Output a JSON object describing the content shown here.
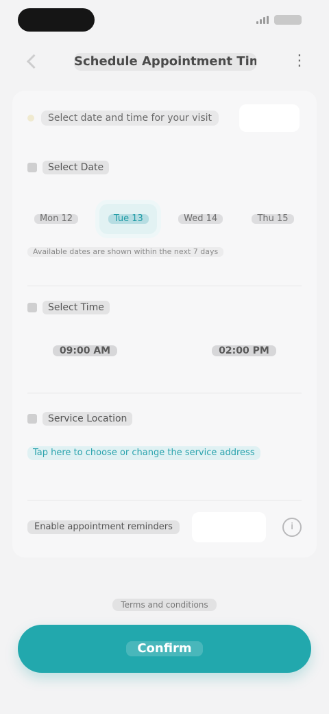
{
  "header": {
    "title": "Schedule Appointment Time",
    "more_icon": "more-icon"
  },
  "hint": {
    "text": "Select date and time for your visit"
  },
  "sections": {
    "date": {
      "label": "Select Date",
      "options": [
        {
          "label": "Mon 12",
          "selected": false
        },
        {
          "label": "Tue 13",
          "selected": true
        },
        {
          "label": "Wed 14",
          "selected": false
        },
        {
          "label": "Thu 15",
          "selected": false
        }
      ],
      "note": "Available dates are shown within the next 7 days"
    },
    "time": {
      "label": "Select Time",
      "options": [
        "09:00 AM",
        "02:00 PM"
      ]
    },
    "location": {
      "label": "Service Location",
      "link_text": "Tap here to choose or change the service address"
    }
  },
  "toggle": {
    "label": "Enable appointment reminders"
  },
  "footer_note": "Terms and conditions",
  "primary_button": {
    "label": "Confirm"
  },
  "colors": {
    "accent": "#22a8ad",
    "background": "#f3f3f4"
  }
}
